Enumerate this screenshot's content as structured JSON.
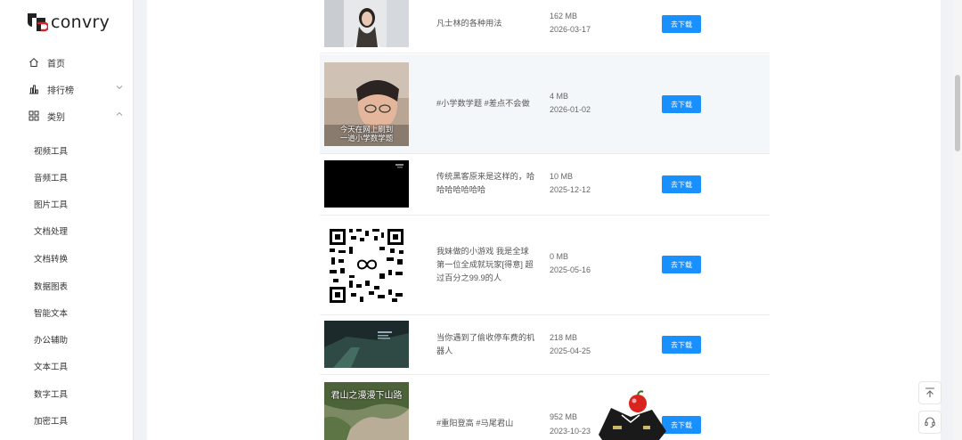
{
  "brand": {
    "name": "convry"
  },
  "nav": {
    "home": "首页",
    "ranking": "排行榜",
    "category": "类别"
  },
  "categories": [
    "视频工具",
    "音频工具",
    "图片工具",
    "文档处理",
    "文档转换",
    "数据图表",
    "智能文本",
    "办公辅助",
    "文本工具",
    "数字工具",
    "加密工具"
  ],
  "videos": [
    {
      "title": "凡士林的各种用法",
      "size": "162 MB",
      "date": "2026-03-17",
      "button": "去下载"
    },
    {
      "title": "#小学数学题 #差点不会做",
      "size": "4 MB",
      "date": "2026-01-02",
      "button": "去下载",
      "thumb_caption_1": "今天在网上刷到",
      "thumb_caption_2": "一道小学数学题"
    },
    {
      "title": "传统黑客原来是这样的，哈哈哈哈哈哈哈",
      "size": "10 MB",
      "date": "2025-12-12",
      "button": "去下载"
    },
    {
      "title": "我妹做的小游戏 我是全球第一位全成就玩家[得意] 超过百分之99.9的人",
      "size": "0 MB",
      "date": "2025-05-16",
      "button": "去下载"
    },
    {
      "title": "当你遇到了偷收停车费的机器人",
      "size": "218 MB",
      "date": "2025-04-25",
      "button": "去下载"
    },
    {
      "title": "#重阳登高 #马尾君山",
      "size": "952 MB",
      "date": "2023-10-23",
      "button": "去下载",
      "thumb_caption_1": "君山之漫漫下山路"
    }
  ],
  "colors": {
    "accent": "#1990ff",
    "highlight_row": "#f4f7fa"
  },
  "icons": [
    "home-icon",
    "bar-chart-icon",
    "grid-icon",
    "chevron-down-icon",
    "chevron-up-icon",
    "back-to-top-icon",
    "headset-icon"
  ]
}
